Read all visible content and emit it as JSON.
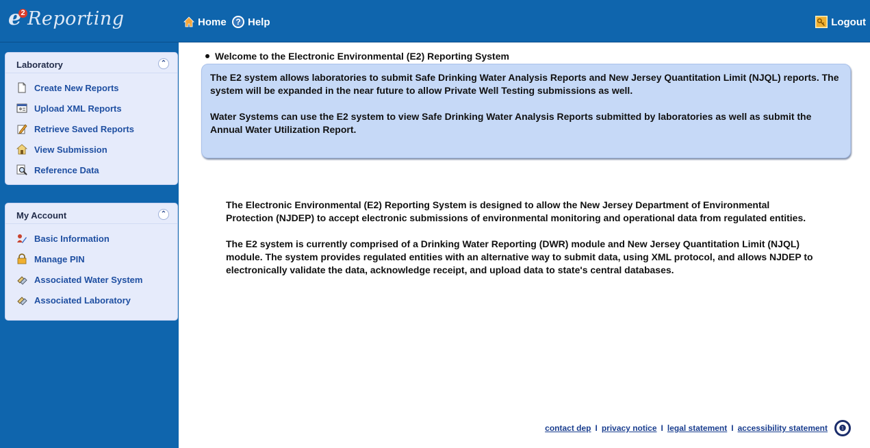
{
  "header": {
    "logo_prefix": "e",
    "logo_superscript": "2",
    "logo_text": "Reporting",
    "nav_home": "Home",
    "nav_help": "Help",
    "nav_help_glyph": "?",
    "nav_logout": "Logout",
    "bar_color": "#0f65ad"
  },
  "sidebar": {
    "laboratory": {
      "title": "Laboratory",
      "collapse_glyph": "⌃",
      "items": [
        {
          "label": "Create New Reports",
          "icon": "document-icon"
        },
        {
          "label": "Upload XML Reports",
          "icon": "xml-upload-icon"
        },
        {
          "label": "Retrieve Saved Reports",
          "icon": "edit-icon"
        },
        {
          "label": "View Submission",
          "icon": "house-lock-icon"
        },
        {
          "label": "Reference Data",
          "icon": "magnifier-icon"
        }
      ]
    },
    "my_account": {
      "title": "My Account",
      "collapse_glyph": "⌃",
      "items": [
        {
          "label": "Basic Information",
          "icon": "user-edit-icon"
        },
        {
          "label": "Manage PIN",
          "icon": "lock-icon"
        },
        {
          "label": "Associated Water System",
          "icon": "link-icon"
        },
        {
          "label": "Associated Laboratory",
          "icon": "link-icon"
        }
      ]
    }
  },
  "main": {
    "welcome_title": "Welcome to the Electronic Environmental (E2) Reporting System",
    "info_paragraphs": [
      "The E2 system allows laboratories to submit Safe Drinking Water Analysis Reports and New Jersey Quantitation Limit (NJQL) reports. The system will be expanded in the near future to allow Private Well Testing submissions as well.",
      "Water Systems can use the E2 system to view Safe Drinking Water Analysis Reports submitted by laboratories as well as submit the Annual Water Utilization Report."
    ],
    "intro_paragraphs": [
      "The Electronic Environmental (E2) Reporting System is designed to allow the New Jersey Department of Environmental Protection (NJDEP) to accept electronic submissions of environmental monitoring and operational data from regulated entities.",
      "The E2 system is currently comprised of a Drinking Water Reporting (DWR) module and New Jersey Quantitation Limit (NJQL) module. The system provides regulated entities with an alternative way to submit data, using XML protocol, and allows NJDEP to electronically validate the data, acknowledge receipt, and upload data to state's central databases."
    ]
  },
  "footer": {
    "links": [
      "contact dep",
      "privacy notice",
      "legal statement",
      "accessibility statement"
    ],
    "separator": "I",
    "seal_glyph": "❶"
  }
}
